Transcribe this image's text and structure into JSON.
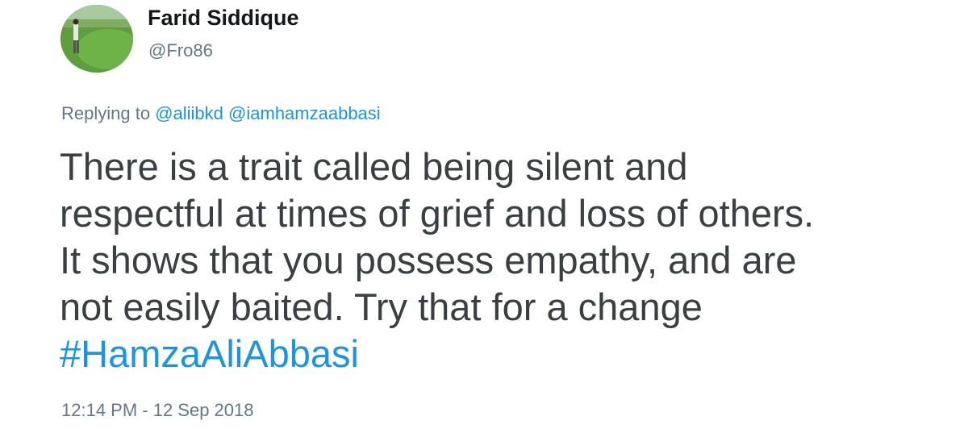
{
  "author": {
    "name": "Farid Siddique",
    "handle": "@Fro86"
  },
  "reply": {
    "prefix": "Replying to",
    "mentions": [
      "@aliibkd",
      "@iamhamzaabbasi"
    ]
  },
  "tweet": {
    "lines": [
      "There is a trait called being silent and",
      "respectful at times of grief and loss of others.",
      "It shows that you possess empathy, and are",
      "not easily baited. Try that for a change"
    ],
    "hashtag": "#HamzaAliAbbasi"
  },
  "timestamp": "12:14 PM - 12 Sep 2018",
  "colors": {
    "link": "#1b95e0",
    "secondary_text": "#657786",
    "body_text": "#3b3f42"
  }
}
